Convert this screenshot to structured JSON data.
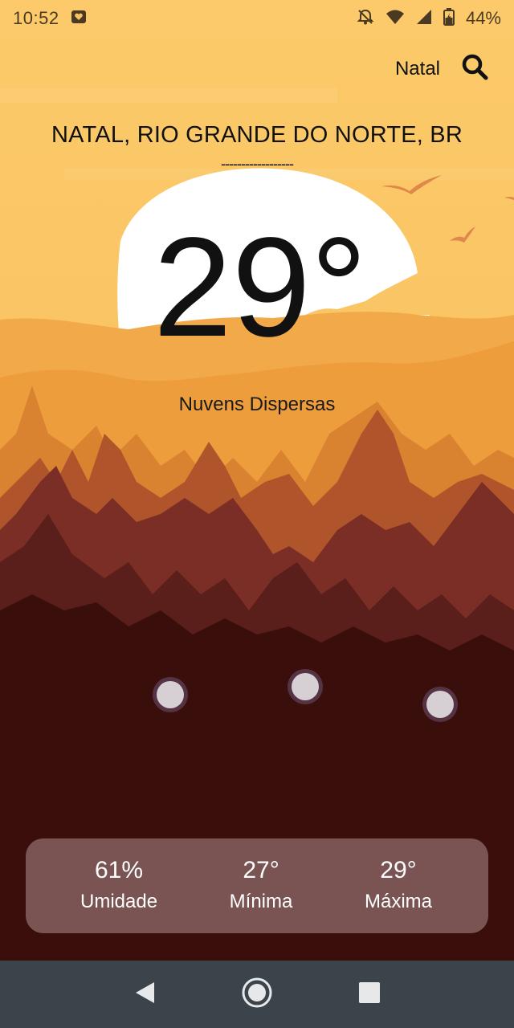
{
  "status_bar": {
    "time": "10:52",
    "battery_percent": "44%",
    "icons": [
      "notification-heart-icon",
      "bell-off-icon",
      "wifi-icon",
      "signal-icon",
      "battery-icon"
    ]
  },
  "search": {
    "city": "Natal",
    "icon": "search-icon"
  },
  "weather": {
    "location": "NATAL, RIO GRANDE DO NORTE, BR",
    "divider": "------------------",
    "temperature": "29°",
    "condition": "Nuvens Dispersas"
  },
  "stats": [
    {
      "value": "61%",
      "label": "Umidade"
    },
    {
      "value": "27°",
      "label": "Mínima"
    },
    {
      "value": "29°",
      "label": "Máxima"
    }
  ],
  "nav": {
    "icons": [
      "back-icon",
      "home-icon",
      "recents-icon"
    ]
  },
  "colors": {
    "sky_top": "#fbc968",
    "sky_bottom": "#f6b556",
    "forest_dark": "#3a0f0b",
    "card": "#876462",
    "nav_bar": "#3b444b"
  }
}
